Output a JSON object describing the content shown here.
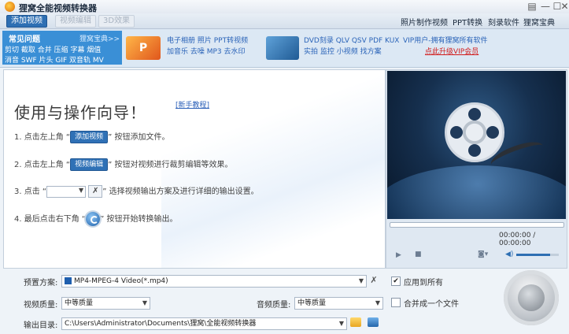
{
  "app": {
    "title": "狸窝全能视频转换器"
  },
  "toolbar": {
    "add_video": "添加视频",
    "edit_video": "视频编辑",
    "effects": "3D效果",
    "links": [
      "照片制作视频",
      "PPT转换",
      "刻录软件",
      "狸窝宝典"
    ]
  },
  "banner": {
    "faq_title": "常见问题",
    "faq_link": "狸窝宝典>>",
    "faq_row1": "剪切 截取 合并 压缩 字幕 烟值",
    "faq_row2": "消音 SWF 片头 GIF 双音轨 MV",
    "promo1_row1": "电子相册 照片 PPT转视频",
    "promo1_row2": "加音乐 去噪 MP3 去水印",
    "promo2_row1": "DVD刻录 QLV QSV PDF KUX",
    "promo2_row2": "实拍 监控 小视频 找方案",
    "vip_row1": "VIP用户-拥有狸窝所有软件",
    "vip_row2": "点此升级VIP会员"
  },
  "guide": {
    "title": "使用与操作向导！",
    "tutorial": "[新手教程]",
    "step1_pre": "1. 点击左上角 “",
    "step1_btn": "添加视频",
    "step1_post": "” 按钮添加文件。",
    "step2_pre": "2. 点击左上角 “",
    "step2_btn": "视频编辑",
    "step2_post": "” 按钮对视频进行裁剪编辑等效果。",
    "step3_pre": "3. 点击 “",
    "step3_post": "” 选择视频输出方案及进行详细的输出设置。",
    "step4_pre": "4. 最后点击右下角 “",
    "step4_post": "” 按钮开始转换输出。"
  },
  "player": {
    "time": "00:00:00 / 00:00:00",
    "volume": 0.8
  },
  "output": {
    "preset_label": "预置方案:",
    "preset_value": "MP4-MPEG-4 Video(*.mp4)",
    "apply_all": "应用到所有",
    "apply_all_checked": true,
    "merge": "合并成一个文件",
    "merge_checked": false,
    "video_quality_label": "视频质量:",
    "video_quality": "中等质量",
    "audio_quality_label": "音频质量:",
    "audio_quality": "中等质量",
    "dir_label": "输出目录:",
    "dir_value": "C:\\Users\\Administrator\\Documents\\狸窝\\全能视频转换器"
  }
}
